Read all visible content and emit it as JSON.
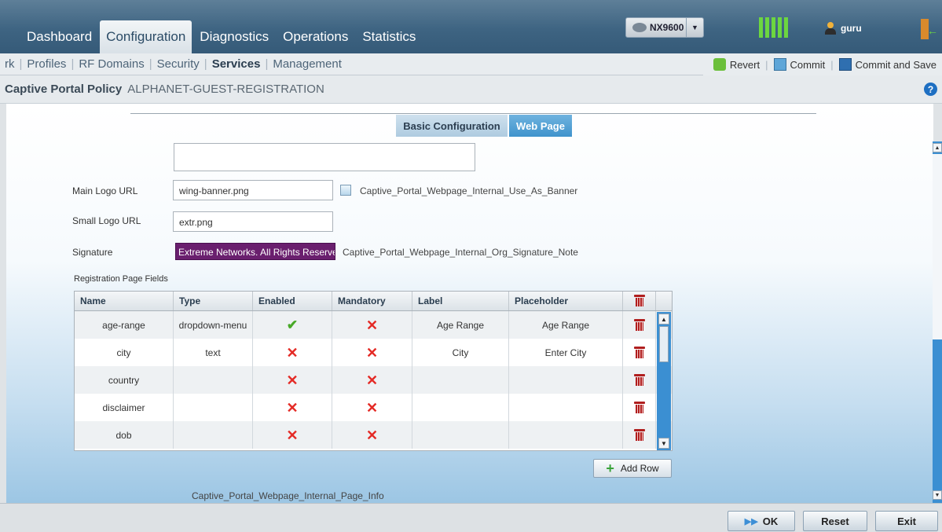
{
  "nav": {
    "tabs": [
      {
        "label": "Dashboard",
        "active": false
      },
      {
        "label": "Configuration",
        "active": true
      },
      {
        "label": "Diagnostics",
        "active": false
      },
      {
        "label": "Operations",
        "active": false
      },
      {
        "label": "Statistics",
        "active": false
      }
    ],
    "device": "NX9600",
    "user": "guru"
  },
  "subnav": {
    "items": [
      "rk",
      "Profiles",
      "RF Domains",
      "Security",
      "Services",
      "Management"
    ],
    "active": "Services",
    "actions": {
      "revert": "Revert",
      "commit": "Commit",
      "commit_save": "Commit and Save"
    }
  },
  "title": {
    "label": "Captive Portal Policy",
    "value": "ALPHANET-GUEST-REGISTRATION"
  },
  "tabs": {
    "basic": "Basic Configuration",
    "web": "Web Page",
    "active": "Web Page"
  },
  "form": {
    "main_logo_label": "Main Logo URL",
    "main_logo_value": "wing-banner.png",
    "banner_checkbox_label": "Captive_Portal_Webpage_Internal_Use_As_Banner",
    "banner_checked": false,
    "small_logo_label": "Small Logo URL",
    "small_logo_value": "extr.png",
    "signature_label": "Signature",
    "signature_value": "Extreme Networks. All Rights Reserved",
    "signature_note": "Captive_Portal_Webpage_Internal_Org_Signature_Note"
  },
  "registration": {
    "title": "Registration Page Fields",
    "columns": [
      "Name",
      "Type",
      "Enabled",
      "Mandatory",
      "Label",
      "Placeholder"
    ],
    "rows": [
      {
        "name": "age-range",
        "type": "dropdown-menu",
        "enabled": true,
        "mandatory": false,
        "label": "Age Range",
        "placeholder": "Age Range"
      },
      {
        "name": "city",
        "type": "text",
        "enabled": false,
        "mandatory": false,
        "label": "City",
        "placeholder": "Enter City"
      },
      {
        "name": "country",
        "type": "",
        "enabled": false,
        "mandatory": false,
        "label": "",
        "placeholder": ""
      },
      {
        "name": "disclaimer",
        "type": "",
        "enabled": false,
        "mandatory": false,
        "label": "",
        "placeholder": ""
      },
      {
        "name": "dob",
        "type": "",
        "enabled": false,
        "mandatory": false,
        "label": "",
        "placeholder": ""
      }
    ],
    "add_row": "Add Row",
    "page_info": "Captive_Portal_Webpage_Internal_Page_Info"
  },
  "footer": {
    "ok": "OK",
    "reset": "Reset",
    "exit": "Exit"
  },
  "colors": {
    "nav_bg": "#3e6482",
    "signature_bg": "#6a1f6e",
    "tab_active": "#3f93cc",
    "x_red": "#e42a25",
    "check_green": "#48a928"
  }
}
